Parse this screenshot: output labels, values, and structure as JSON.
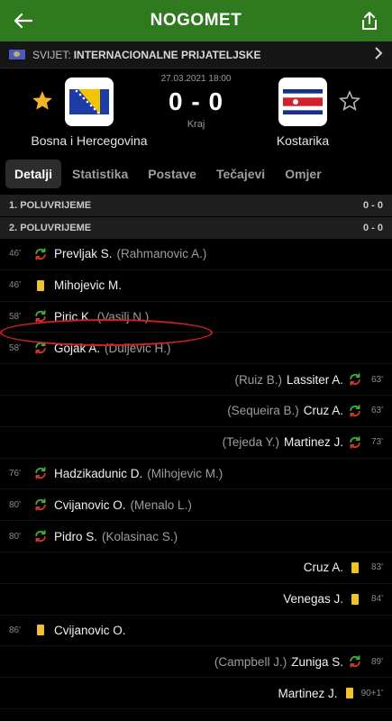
{
  "header": {
    "title": "NOGOMET"
  },
  "league": {
    "country": "SVIJET:",
    "competition": "INTERNACIONALNE PRIJATELJSKE"
  },
  "match": {
    "date": "27.03.2021 18:00",
    "score": "0 - 0",
    "status": "Kraj",
    "home": {
      "name": "Bosna i Hercegovina",
      "favorite": true
    },
    "away": {
      "name": "Kostarika",
      "favorite": false
    }
  },
  "tabs": [
    "Detalji",
    "Statistika",
    "Postave",
    "Tečajevi",
    "Omjer"
  ],
  "halves": [
    {
      "label": "1. POLUVRIJEME",
      "score": "0 - 0"
    },
    {
      "label": "2. POLUVRIJEME",
      "score": "0 - 0"
    }
  ],
  "events": [
    {
      "side": "home",
      "minute": "46'",
      "type": "substitution",
      "player": "Prevljak S.",
      "assist": "(Rahmanovic A.)"
    },
    {
      "side": "home",
      "minute": "46'",
      "type": "yellow-card",
      "player": "Mihojevic M.",
      "assist": ""
    },
    {
      "side": "home",
      "minute": "58'",
      "type": "substitution",
      "player": "Piric K.",
      "assist": "(Vasilj N.)"
    },
    {
      "side": "home",
      "minute": "58'",
      "type": "substitution",
      "player": "Gojak A.",
      "assist": "(Duljevic H.)"
    },
    {
      "side": "away",
      "minute": "63'",
      "type": "substitution",
      "player": "Lassiter A.",
      "assist": "(Ruiz B.)"
    },
    {
      "side": "away",
      "minute": "63'",
      "type": "substitution",
      "player": "Cruz A.",
      "assist": "(Sequeira B.)"
    },
    {
      "side": "away",
      "minute": "73'",
      "type": "substitution",
      "player": "Martinez J.",
      "assist": "(Tejeda Y.)"
    },
    {
      "side": "home",
      "minute": "76'",
      "type": "substitution",
      "player": "Hadzikadunic D.",
      "assist": "(Mihojevic M.)"
    },
    {
      "side": "home",
      "minute": "80'",
      "type": "substitution",
      "player": "Cvijanovic O.",
      "assist": "(Menalo L.)"
    },
    {
      "side": "home",
      "minute": "80'",
      "type": "substitution",
      "player": "Pidro S.",
      "assist": "(Kolasinac S.)"
    },
    {
      "side": "away",
      "minute": "83'",
      "type": "yellow-card",
      "player": "Cruz A.",
      "assist": ""
    },
    {
      "side": "away",
      "minute": "84'",
      "type": "yellow-card",
      "player": "Venegas J.",
      "assist": ""
    },
    {
      "side": "home",
      "minute": "86'",
      "type": "yellow-card",
      "player": "Cvijanovic O.",
      "assist": ""
    },
    {
      "side": "away",
      "minute": "89'",
      "type": "substitution",
      "player": "Zuniga S.",
      "assist": "(Campbell J.)"
    },
    {
      "side": "away",
      "minute": "90+1'",
      "type": "yellow-card",
      "player": "Martinez J.",
      "assist": ""
    }
  ],
  "colors": {
    "brand": "#2f7a1f",
    "yellow_card": "#f2c12e",
    "star": "#f0b429",
    "highlight": "#d21f1f"
  }
}
